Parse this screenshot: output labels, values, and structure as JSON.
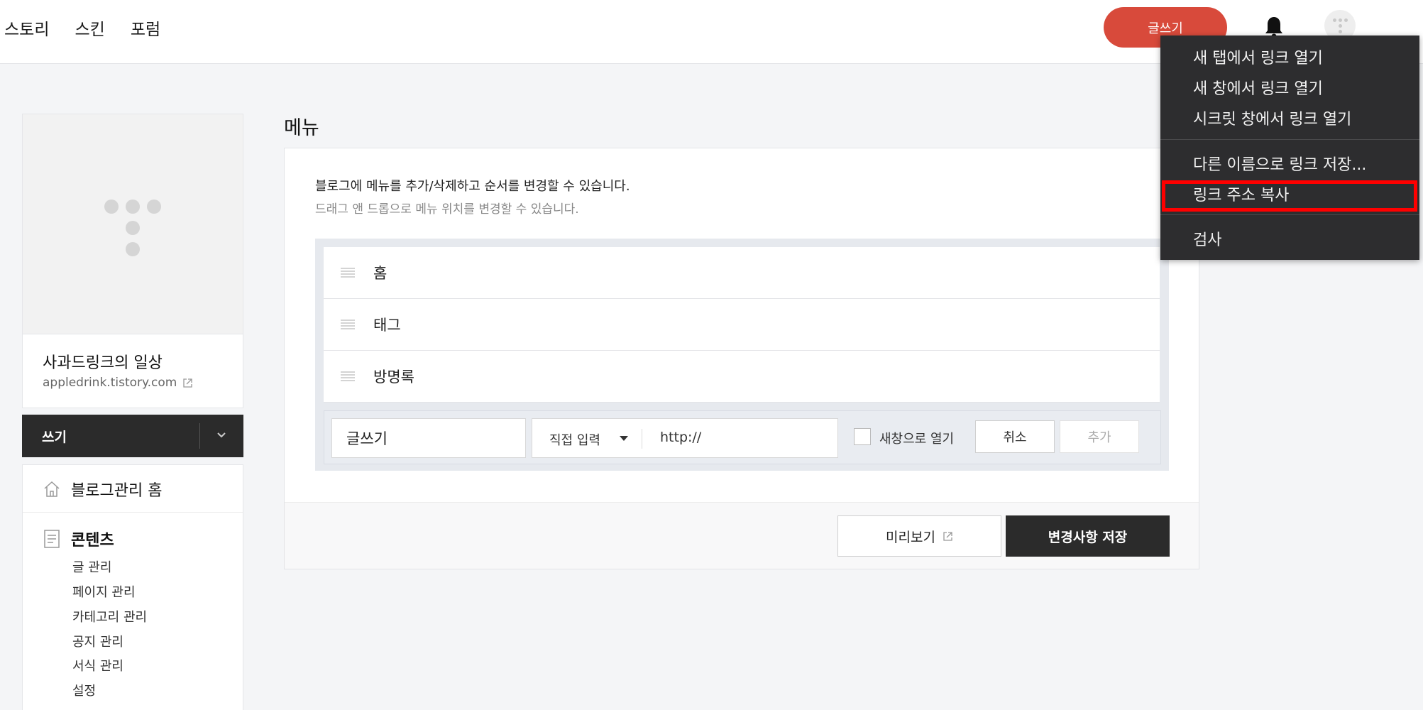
{
  "topnav": {
    "items": [
      "스토리",
      "스킨",
      "포럼"
    ],
    "write_button": "글쓰기"
  },
  "blog": {
    "name": "사과드링크의 일상",
    "url": "appledrink.tistory.com"
  },
  "sidebar": {
    "write_label": "쓰기",
    "home_label": "블로그관리 홈",
    "contents_label": "콘텐츠",
    "sub_items": [
      "글 관리",
      "페이지 관리",
      "카테고리 관리",
      "공지 관리",
      "서식 관리",
      "설정"
    ]
  },
  "main": {
    "title": "메뉴",
    "desc1": "블로그에 메뉴를 추가/삭제하고 순서를 변경할 수 있습니다.",
    "desc2": "드래그 앤 드롭으로 메뉴 위치를 변경할 수 있습니다.",
    "menu_items": [
      "홈",
      "태그",
      "방명록"
    ],
    "input": {
      "name_value": "글쓰기",
      "type_selected": "직접 입력",
      "url_value": "http://",
      "new_window_label": "새창으로 열기",
      "cancel_label": "취소",
      "add_label": "추가"
    },
    "preview_label": "미리보기",
    "save_label": "변경사항 저장"
  },
  "context_menu": {
    "items": [
      "새 탭에서 링크 열기",
      "새 창에서 링크 열기",
      "시크릿 창에서 링크 열기",
      "다른 이름으로 링크 저장...",
      "링크 주소 복사",
      "검사"
    ],
    "highlighted_item": "링크 주소 복사",
    "highlight_color": "#ff0000"
  },
  "colors": {
    "accent": "#d84a3b",
    "dark": "#2b2b2b",
    "menu_bg": "#2d2d2f"
  }
}
